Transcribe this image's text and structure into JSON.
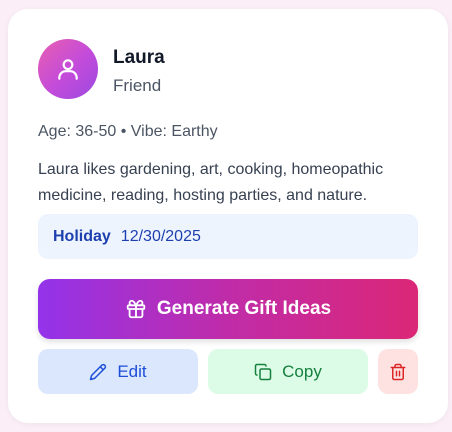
{
  "contact": {
    "name": "Laura",
    "relation": "Friend",
    "meta": "Age: 36-50 • Vibe: Earthy",
    "description": "Laura likes gardening, art, cooking, homeopathic medicine, reading, hosting parties, and nature."
  },
  "occasion": {
    "name": "Holiday",
    "date": "12/30/2025"
  },
  "actions": {
    "generate_label": "Generate Gift Ideas",
    "edit_label": "Edit",
    "copy_label": "Copy"
  },
  "icons": {
    "avatar": "user-icon",
    "generate": "gift-icon",
    "edit": "pencil-icon",
    "copy": "copy-icon",
    "delete": "trash-icon"
  },
  "colors": {
    "generate_gradient_start": "#9333ea",
    "generate_gradient_end": "#db2777",
    "edit_bg": "#dbe7fd",
    "copy_bg": "#dcfce7",
    "delete_bg": "#fee2e2"
  }
}
